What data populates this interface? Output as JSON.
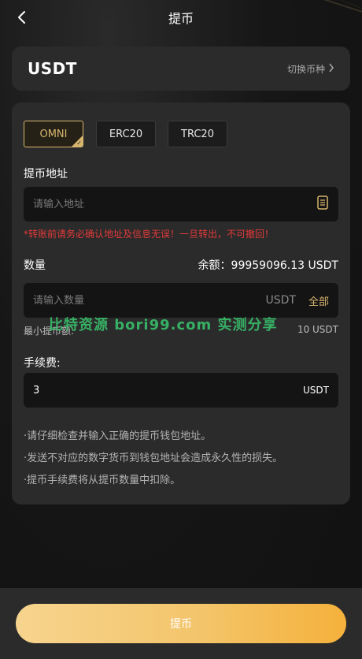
{
  "header": {
    "title": "提币",
    "back_icon": "chevron-left-icon"
  },
  "coin": {
    "name": "USDT",
    "switch_label": "切换币种",
    "switch_icon": "chevron-right-icon"
  },
  "chains": [
    {
      "label": "OMNI",
      "active": true
    },
    {
      "label": "ERC20",
      "active": false
    },
    {
      "label": "TRC20",
      "active": false
    }
  ],
  "address": {
    "label": "提币地址",
    "placeholder": "请输入地址",
    "icon": "document-icon",
    "warning": "*转账前请务必确认地址及信息无误！一旦转出，不可撤回！"
  },
  "amount": {
    "label": "数量",
    "balance_text": "余额：99959096.13 USDT",
    "placeholder": "请输入数量",
    "unit": "USDT",
    "all_label": "全部",
    "min_label": "最小提币额:",
    "min_value": "10 USDT"
  },
  "fee": {
    "label": "手续费:",
    "value": "3",
    "unit": "USDT"
  },
  "notes": [
    "·请仔细检查并输入正确的提币钱包地址。",
    "·发送不对应的数字货币到钱包地址会造成永久性的损失。",
    "·提币手续费将从提币数量中扣除。"
  ],
  "watermark": "比特资源 bori99.com 实测分享",
  "submit_label": "提币",
  "colors": {
    "accent": "#d7b56d",
    "warning": "#e23a3a",
    "card": "#2b2b2b",
    "input": "#141414"
  }
}
